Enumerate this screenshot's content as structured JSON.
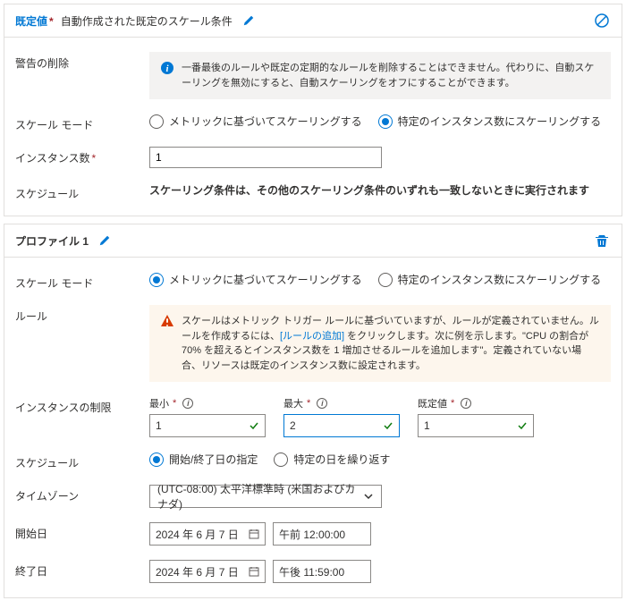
{
  "panel1": {
    "title": "既定値",
    "subtitle": "自動作成された既定のスケール条件",
    "deleteWarnLabel": "警告の削除",
    "deleteWarnText": "一番最後のルールや既定の定期的なルールを削除することはできません。代わりに、自動スケーリングを無効にすると、自動スケーリングをオフにすることができます。",
    "scaleModeLabel": "スケール モード",
    "scaleModeMetric": "メトリックに基づいてスケーリングする",
    "scaleModeFixed": "特定のインスタンス数にスケーリングする",
    "instanceCountLabel": "インスタンス数",
    "instanceCountValue": "1",
    "scheduleLabel": "スケジュール",
    "scheduleText": "スケーリング条件は、その他のスケーリング条件のいずれも一致しないときに実行されます"
  },
  "panel2": {
    "title": "プロファイル 1",
    "scaleModeLabel": "スケール モード",
    "scaleModeMetric": "メトリックに基づいてスケーリングする",
    "scaleModeFixed": "特定のインスタンス数にスケーリングする",
    "rulesLabel": "ルール",
    "rulesWarnPre": "スケールはメトリック トリガー ルールに基づいていますが、ルールが定義されていません。ルールを作成するには、",
    "rulesWarnLink": "[ルールの追加]",
    "rulesWarnPost": " をクリックします。次に例を示します。\"CPU の割合が 70% を超えるとインスタンス数を 1 増加させるルールを追加します\"。定義されていない場合、リソースは既定のインスタンス数に設定されます。",
    "limitsLabel": "インスタンスの制限",
    "minLabel": "最小",
    "minValue": "1",
    "maxLabel": "最大",
    "maxValue": "2",
    "defaultLabel": "既定値",
    "defaultValue": "1",
    "scheduleLabel": "スケジュール",
    "scheduleStartEnd": "開始/終了日の指定",
    "scheduleRepeat": "特定の日を繰り返す",
    "tzLabel": "タイムゾーン",
    "tzValue": "(UTC-08:00) 太平洋標準時 (米国およびカナダ)",
    "startLabel": "開始日",
    "startDate": "2024 年 6 月 7 日",
    "startTime": "午前 12:00:00",
    "endLabel": "終了日",
    "endDate": "2024 年 6 月 7 日",
    "endTime": "午後 11:59:00"
  }
}
